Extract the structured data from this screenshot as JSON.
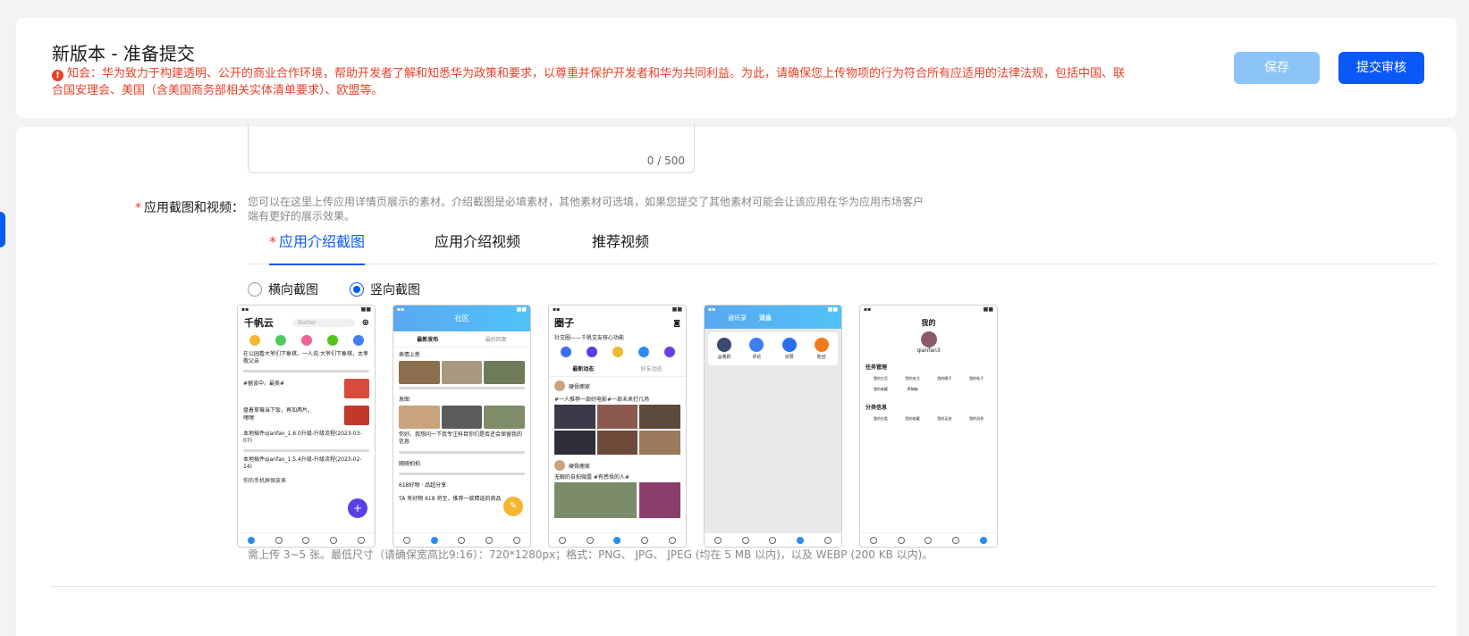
{
  "header": {
    "title": "新版本 - 准备提交",
    "notice": "知会：华为致力于构建透明、公开的商业合作环境，帮助开发者了解和知悉华为政策和要求，以尊重并保护开发者和华为共同利益。为此，请确保您上传物项的行为符合所有应适用的法律法规，包括中国、联合国安理会、美国（含美国商务部相关实体清单要求）、欧盟等。",
    "save_label": "保存",
    "submit_label": "提交审核"
  },
  "textarea": {
    "count": "0 / 500"
  },
  "screenshots_field": {
    "required_mark": "*",
    "label": "应用截图和视频：",
    "description": "您可以在这里上传应用详情页展示的素材。介绍截图是必填素材，其他素材可选填，如果您提交了其他素材可能会让该应用在华为应用市场客户端有更好的展示效果。",
    "tabs": [
      {
        "label": "应用介绍截图",
        "required_mark": "*"
      },
      {
        "label": "应用介绍视频"
      },
      {
        "label": "推荐视频"
      }
    ],
    "orientation": {
      "options": [
        "横向截图",
        "竖向截图"
      ],
      "selected": "竖向截图"
    },
    "shots": {
      "s1": {
        "logo": "千帆云",
        "search": "Doctor",
        "posts": [
          "在公园看大爷们下象棋，一人说:大爷们下象棋，太孝敬父亲",
          "#据谈中，最美#",
          "盘着草莓当下饭，再加两片，嘿嘿",
          "本地插件qianfan_1.6.0升级-升级流程(2023-03-07)",
          "本地插件qianfan_1.5.4升级-升级流程(2023-02-14)",
          "你的手机屏保皮表"
        ]
      },
      "s2": {
        "title": "社区",
        "tabs": [
          "最新发布",
          "最后回复"
        ],
        "sections": [
          "表情上新",
          "发图",
          "你好。我想问一下我专注科目你们是否还会保留我的信息",
          "随随拍拍",
          "618好物 · 品超分享",
          "TA 有好物 618 将至，推荐一款精选的商品"
        ]
      },
      "s3": {
        "logo": "圈子",
        "banner": "社交圈——千帆交友核心功能",
        "tabs": [
          "最新动态",
          "好友动态"
        ],
        "users": [
          "硬骨鹿家",
          "硬骨鹿家"
        ],
        "post": "#一人推荐一部好电影#一部未来打几场",
        "post2": "无聊的自拍微露 #有感悟的人#"
      },
      "s4": {
        "tabs": [
          "通讯录",
          "消息"
        ],
        "actions": [
          "@我的",
          "评论",
          "点赞",
          "粉丝"
        ]
      },
      "s5": {
        "title": "我的",
        "username": "qianfan3",
        "sections": [
          "任务管理",
          "分类信息"
        ],
        "items1": [
          "我的主页",
          "我的关注",
          "我的圈子",
          "我的帖子",
          "我的收藏",
          "草稿箱"
        ],
        "items2": [
          "我的分类",
          "我的收藏",
          "我的足迹",
          "我的消息"
        ]
      }
    },
    "hint": "需上传 3~5 张。最低尺寸（请确保宽高比9:16）：720*1280px；格式：PNG、 JPG、 JPEG (均在 5 MB 以内)，以及 WEBP (200 KB 以内)。"
  },
  "colors": {
    "accent": "#0a59f7",
    "danger": "#e84026",
    "disabled": "#8cc4fa"
  }
}
